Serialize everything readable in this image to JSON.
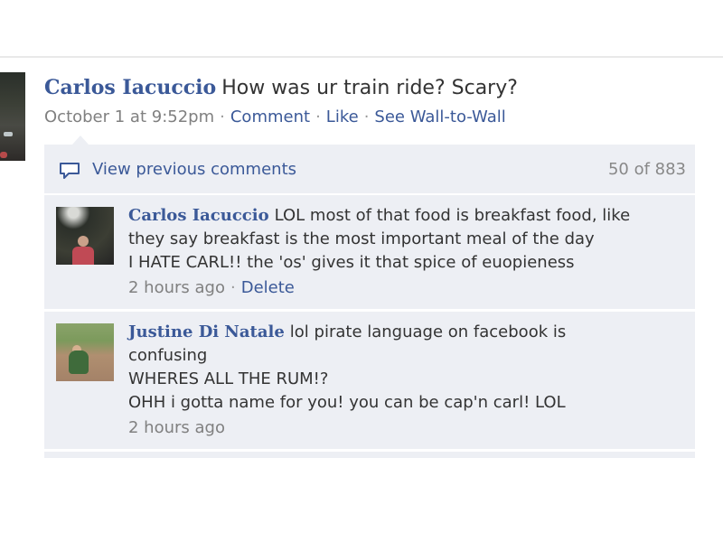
{
  "story": {
    "author": "Carlos Iacuccio",
    "text": "How was ur train ride? Scary?",
    "timestamp": "October 1 at 9:52pm",
    "actions": [
      "Comment",
      "Like",
      "See Wall-to-Wall"
    ]
  },
  "view_previous": {
    "label": "View previous comments",
    "count": "50 of 883",
    "icon": "comment-bubble-icon"
  },
  "comments": [
    {
      "author": "Carlos Iacuccio",
      "lines": [
        "LOL most of that food is breakfast food, like",
        "they say breakfast is the most important meal of the day",
        "I HATE CARL!! the 'os' gives it that spice of euopieness"
      ],
      "time": "2 hours ago",
      "delete_label": "Delete"
    },
    {
      "author": "Justine Di Natale",
      "lines": [
        "lol pirate language on facebook is",
        "confusing",
        "WHERES ALL THE RUM!?",
        "OHH i gotta name for you! you can be cap'n carl! LOL"
      ],
      "time": "2 hours ago"
    }
  ],
  "colors": {
    "link": "#3b5998",
    "panel": "#edeff4",
    "meta": "#808080"
  }
}
